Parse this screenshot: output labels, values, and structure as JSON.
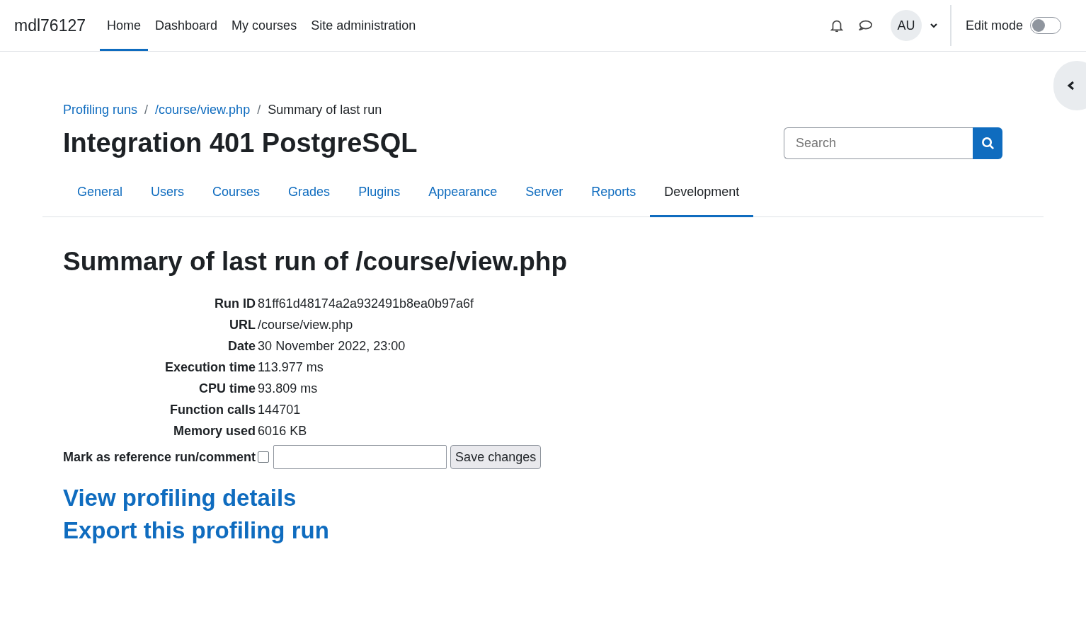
{
  "site_name": "mdl76127",
  "primary_nav": [
    {
      "label": "Home",
      "selected": true
    },
    {
      "label": "Dashboard",
      "selected": false
    },
    {
      "label": "My courses",
      "selected": false
    },
    {
      "label": "Site administration",
      "selected": false
    }
  ],
  "user_initials": "AU",
  "edit_mode": {
    "label": "Edit mode",
    "on": false
  },
  "breadcrumbs": [
    {
      "label": "Profiling runs",
      "kind": "link"
    },
    {
      "separator": "/",
      "label": "/course/view.php",
      "kind": "link"
    },
    {
      "separator": "/",
      "label": "Summary of last run",
      "kind": "current"
    }
  ],
  "page_title": "Integration 401 PostgreSQL",
  "search": {
    "placeholder": "Search"
  },
  "secondary_nav": [
    {
      "label": "General",
      "selected": false
    },
    {
      "label": "Users",
      "selected": false
    },
    {
      "label": "Courses",
      "selected": false
    },
    {
      "label": "Grades",
      "selected": false
    },
    {
      "label": "Plugins",
      "selected": false
    },
    {
      "label": "Appearance",
      "selected": false
    },
    {
      "label": "Server",
      "selected": false
    },
    {
      "label": "Reports",
      "selected": false
    },
    {
      "label": "Development",
      "selected": true
    }
  ],
  "heading": "Summary of last run of /course/view.php",
  "summary": [
    {
      "label": "Run ID",
      "value": "81ff61d48174a2a932491b8ea0b97a6f"
    },
    {
      "label": "URL",
      "value": "/course/view.php"
    },
    {
      "label": "Date",
      "value": "30 November 2022, 23:00"
    },
    {
      "label": "Execution time",
      "value": "113.977 ms"
    },
    {
      "label": "CPU time",
      "value": "93.809 ms"
    },
    {
      "label": "Function calls",
      "value": "144701"
    },
    {
      "label": "Memory used",
      "value": "6016 KB"
    }
  ],
  "reference": {
    "label": "Mark as reference run/comment",
    "checked": false,
    "button": "Save changes"
  },
  "links": [
    "View profiling details",
    "Export this profiling run"
  ]
}
